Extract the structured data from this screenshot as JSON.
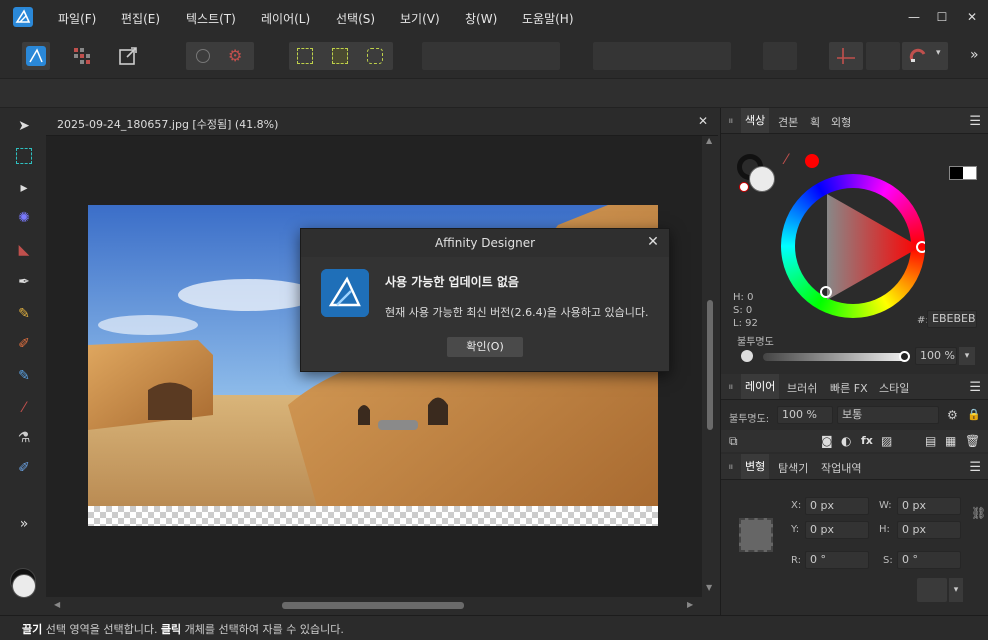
{
  "menu": {
    "items": [
      "파일(F)",
      "편집(E)",
      "텍스트(T)",
      "레이어(L)",
      "선택(S)",
      "보기(V)",
      "창(W)",
      "도움말(H)"
    ]
  },
  "window_controls": {
    "minimize": "—",
    "maximize": "☐",
    "close": "✕"
  },
  "toolbar": {
    "overflow": "»"
  },
  "document": {
    "tab_title": "2025-09-24_180657.jpg [수정됨] (41.8%)",
    "close": "✕"
  },
  "dialog": {
    "title": "Affinity Designer",
    "heading": "사용 가능한 업데이트 없음",
    "message": "현재 사용 가능한 최신 버전(2.6.4)을 사용하고 있습니다.",
    "ok_label": "확인(O)",
    "close": "✕"
  },
  "color_panel": {
    "tabs": [
      "색상",
      "견본",
      "획",
      "외형"
    ],
    "h": "H: 0",
    "s": "S: 0",
    "l": "L: 92",
    "hex_label": "#:",
    "hex_value": "EBEBEB",
    "opacity_label": "불투명도",
    "opacity_value": "100 %"
  },
  "layers_panel": {
    "tabs": [
      "레이어",
      "브러쉬",
      "빠른 FX",
      "스타일"
    ],
    "opacity_label": "불투명도:",
    "opacity_value": "100 %",
    "blend_mode": "보통"
  },
  "transform_panel": {
    "tabs": [
      "변형",
      "탐색기",
      "작업내역"
    ],
    "x_label": "X:",
    "x_value": "0 px",
    "y_label": "Y:",
    "y_value": "0 px",
    "w_label": "W:",
    "w_value": "0 px",
    "h_label": "H:",
    "h_value": "0 px",
    "r_label": "R:",
    "r_value": "0 °",
    "s_label": "S:",
    "s_value": "0 °"
  },
  "status": {
    "drag_bold": "끌기",
    "drag_text": " 선택 영역을 선택합니다. ",
    "click_bold": "클릭",
    "click_text": " 개체를 선택하여 자를 수 있습니다."
  },
  "colors": {
    "accent": "#1f6fb8",
    "bg": "#2b2b2b",
    "dialog": "#333333",
    "selected_fill": "#EBEBEB"
  }
}
